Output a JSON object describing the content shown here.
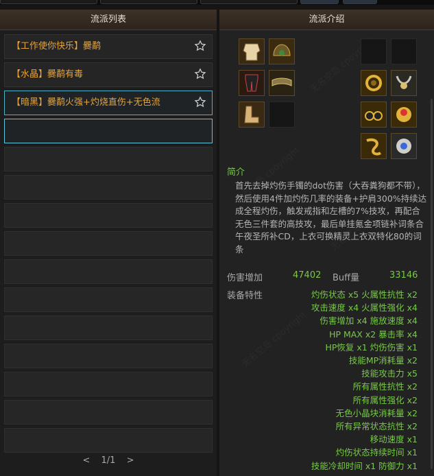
{
  "left_panel": {
    "title": "流派列表",
    "builds": [
      {
        "label": "【工作使你快乐】爨鹬"
      },
      {
        "label": "【水晶】爨鹬有毒"
      },
      {
        "label": "【暗黑】爨鹬火强+灼烧直伤+无色流"
      }
    ],
    "pager": {
      "prev": "<",
      "current": "1/1",
      "next": ">"
    }
  },
  "right_panel": {
    "title": "流派介绍",
    "intro_heading": "简介",
    "intro_text": "首先去掉灼伤手镯的dot伤害（大吞粪狗都不带），然后使用4件加灼伤几率的装备+护肩300%持续达成全程灼伤，触发戒指和左槽的7%技攻，再配合无色三件套的高技攻，最后单挂氪金项链补词条合午夜圣所补CD，上衣可换精灵上衣双特化80的词条",
    "damage_label": "伤害增加",
    "damage_value": "47402",
    "buff_label": "Buff量",
    "buff_value": "33146",
    "traits_label": "装备特性",
    "traits": [
      "灼伤状态 x5   火属性抗性 x2",
      "攻击速度 x4   火属性强化 x4",
      "伤害增加 x4   施放速度 x4",
      "HP MAX x2   暴击率 x4",
      "HP恢复 x1   灼伤伤害 x1",
      "技能MP消耗量 x2",
      "技能攻击力 x5",
      "所有属性抗性 x2",
      "所有属性强化 x2",
      "无色小晶块消耗量 x2",
      "所有异常状态抗性 x2",
      "移动速度 x1",
      "灼伤状态持续时间 x1",
      "技能冷却时间 x1   防御力 x1"
    ],
    "watermark": "无名空岛 cpoyright"
  },
  "colors": {
    "accent_gold": "#e5a33a",
    "accent_green": "#79c84a",
    "select_border": "#4fb3c8"
  }
}
